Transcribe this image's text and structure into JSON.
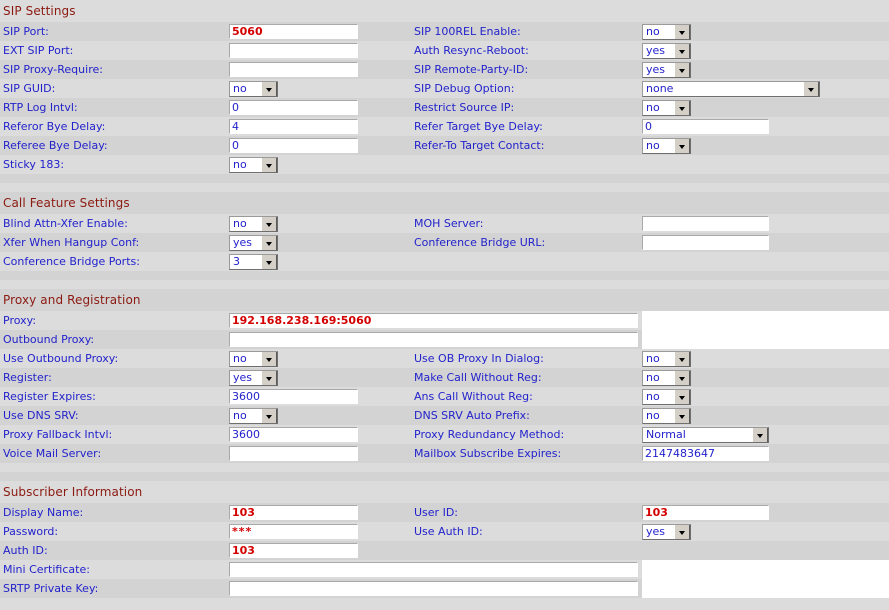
{
  "colors": {
    "section_header": "#8b1a11",
    "label": "#2222cc",
    "value_red": "#d40000",
    "row_light": "#dcdcdc",
    "row_dark": "#d3d3d3"
  },
  "sections": [
    {
      "title": "SIP Settings",
      "rows": [
        {
          "left": {
            "label": "SIP Port:",
            "type": "text",
            "value": "5060",
            "style": "red",
            "width": "narrow"
          },
          "right": {
            "label": "SIP 100REL Enable:",
            "type": "select",
            "value": "no",
            "width": "small"
          }
        },
        {
          "left": {
            "label": "EXT SIP Port:",
            "type": "text",
            "value": "",
            "width": "narrow"
          },
          "right": {
            "label": "Auth Resync-Reboot:",
            "type": "select",
            "value": "yes",
            "width": "small"
          }
        },
        {
          "left": {
            "label": "SIP Proxy-Require:",
            "type": "text",
            "value": "",
            "width": "narrow"
          },
          "right": {
            "label": "SIP Remote-Party-ID:",
            "type": "select",
            "value": "yes",
            "width": "small"
          }
        },
        {
          "left": {
            "label": "SIP GUID:",
            "type": "select",
            "value": "no",
            "width": "small"
          },
          "right": {
            "label": "SIP Debug Option:",
            "type": "select",
            "value": "none",
            "width": "large"
          }
        },
        {
          "left": {
            "label": "RTP Log Intvl:",
            "type": "text",
            "value": "0",
            "width": "narrow"
          },
          "right": {
            "label": "Restrict Source IP:",
            "type": "select",
            "value": "no",
            "width": "small"
          }
        },
        {
          "left": {
            "label": "Referor Bye Delay:",
            "type": "text",
            "value": "4",
            "width": "narrow"
          },
          "right": {
            "label": "Refer Target Bye Delay:",
            "type": "text",
            "value": "0",
            "width": "rightfield"
          }
        },
        {
          "left": {
            "label": "Referee Bye Delay:",
            "type": "text",
            "value": "0",
            "width": "narrow"
          },
          "right": {
            "label": "Refer-To Target Contact:",
            "type": "select",
            "value": "no",
            "width": "small"
          }
        },
        {
          "left": {
            "label": "Sticky 183:",
            "type": "select",
            "value": "no",
            "width": "small"
          },
          "right": null
        }
      ]
    },
    {
      "title": "Call Feature Settings",
      "rows": [
        {
          "left": {
            "label": "Blind Attn-Xfer Enable:",
            "type": "select",
            "value": "no",
            "width": "small"
          },
          "right": {
            "label": "MOH Server:",
            "type": "text",
            "value": "",
            "width": "rightfield"
          }
        },
        {
          "left": {
            "label": "Xfer When Hangup Conf:",
            "type": "select",
            "value": "yes",
            "width": "small"
          },
          "right": {
            "label": "Conference Bridge URL:",
            "type": "text",
            "value": "",
            "width": "rightfield"
          }
        },
        {
          "left": {
            "label": "Conference Bridge Ports:",
            "type": "select",
            "value": "3",
            "width": "small"
          },
          "right": null
        }
      ]
    },
    {
      "title": "Proxy and Registration",
      "rows": [
        {
          "left": {
            "label": "Proxy:",
            "type": "text",
            "value": "192.168.238.169:5060",
            "style": "red",
            "width": "wide"
          },
          "right": null
        },
        {
          "left": {
            "label": "Outbound Proxy:",
            "type": "text",
            "value": "",
            "width": "wide"
          },
          "right": null
        },
        {
          "left": {
            "label": "Use Outbound Proxy:",
            "type": "select",
            "value": "no",
            "width": "small"
          },
          "right": {
            "label": "Use OB Proxy In Dialog:",
            "type": "select",
            "value": "no",
            "width": "small"
          }
        },
        {
          "left": {
            "label": "Register:",
            "type": "select",
            "value": "yes",
            "width": "small"
          },
          "right": {
            "label": "Make Call Without Reg:",
            "type": "select",
            "value": "no",
            "width": "small"
          }
        },
        {
          "left": {
            "label": "Register Expires:",
            "type": "text",
            "value": "3600",
            "width": "narrow"
          },
          "right": {
            "label": "Ans Call Without Reg:",
            "type": "select",
            "value": "no",
            "width": "small"
          }
        },
        {
          "left": {
            "label": "Use DNS SRV:",
            "type": "select",
            "value": "no",
            "width": "small"
          },
          "right": {
            "label": "DNS SRV Auto Prefix:",
            "type": "select",
            "value": "no",
            "width": "small"
          }
        },
        {
          "left": {
            "label": "Proxy Fallback Intvl:",
            "type": "text",
            "value": "3600",
            "width": "narrow"
          },
          "right": {
            "label": "Proxy Redundancy Method:",
            "type": "select",
            "value": "Normal",
            "width": "medium"
          }
        },
        {
          "left": {
            "label": "Voice Mail Server:",
            "type": "text",
            "value": "",
            "width": "narrow"
          },
          "right": {
            "label": "Mailbox Subscribe Expires:",
            "type": "text",
            "value": "2147483647",
            "width": "rightfield"
          }
        }
      ]
    },
    {
      "title": "Subscriber Information",
      "rows": [
        {
          "left": {
            "label": "Display Name:",
            "type": "text",
            "value": "103",
            "style": "red",
            "width": "narrow"
          },
          "right": {
            "label": "User ID:",
            "type": "text",
            "value": "103",
            "style": "red",
            "width": "rightfield"
          }
        },
        {
          "left": {
            "label": "Password:",
            "type": "text",
            "value": "***",
            "style": "password",
            "width": "narrow"
          },
          "right": {
            "label": "Use Auth ID:",
            "type": "select",
            "value": "yes",
            "width": "small"
          }
        },
        {
          "left": {
            "label": "Auth ID:",
            "type": "text",
            "value": "103",
            "style": "red",
            "width": "narrow"
          },
          "right": null
        },
        {
          "left": {
            "label": "Mini Certificate:",
            "type": "text",
            "value": "",
            "width": "wide"
          },
          "right": null
        },
        {
          "left": {
            "label": "SRTP Private Key:",
            "type": "text",
            "value": "",
            "width": "wide"
          },
          "right": null
        }
      ]
    }
  ]
}
